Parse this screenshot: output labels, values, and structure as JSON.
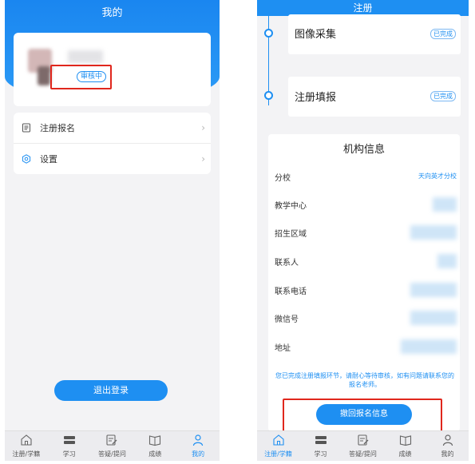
{
  "left_screen": {
    "title": "我的",
    "profile": {
      "status_badge": "审核中"
    },
    "menu": [
      {
        "label": "注册报名",
        "icon": "document-icon"
      },
      {
        "label": "设置",
        "icon": "settings-icon"
      }
    ],
    "logout_label": "退出登录"
  },
  "right_screen": {
    "title": "注册",
    "steps": [
      {
        "label": "图像采集",
        "status": "已完成"
      },
      {
        "label": "注册填报",
        "status": "已完成"
      }
    ],
    "org_info": {
      "title": "机构信息",
      "rows": [
        {
          "label": "分校",
          "value": "天向英才分校"
        },
        {
          "label": "教学中心",
          "value": ""
        },
        {
          "label": "招生区域",
          "value": ""
        },
        {
          "label": "联系人",
          "value": ""
        },
        {
          "label": "联系电话",
          "value": ""
        },
        {
          "label": "微信号",
          "value": ""
        },
        {
          "label": "地址",
          "value": ""
        }
      ],
      "note": "您已完成注册填报环节，请耐心等待审核，如有问题请联系您的报名老师。",
      "revoke_label": "撤回报名信息"
    }
  },
  "tabbar": [
    {
      "label": "注册/学籍",
      "icon": "home-icon"
    },
    {
      "label": "学习",
      "icon": "study-icon"
    },
    {
      "label": "答疑/提问",
      "icon": "edit-icon"
    },
    {
      "label": "成绩",
      "icon": "book-icon"
    },
    {
      "label": "我的",
      "icon": "person-icon"
    }
  ],
  "colors": {
    "accent": "#1e8ff2",
    "highlight": "#e0271d"
  }
}
